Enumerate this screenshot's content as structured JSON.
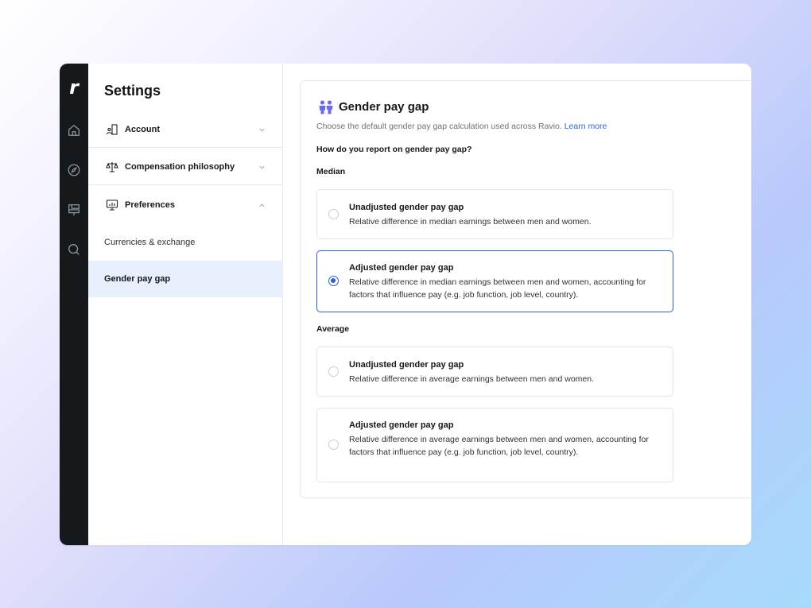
{
  "rail": {
    "logo": "r",
    "icons": [
      "home-icon",
      "compass-icon",
      "layout-icon",
      "search-icon"
    ]
  },
  "sidebar": {
    "title": "Settings",
    "sections": [
      {
        "label": "Account",
        "icon": "building-user-icon",
        "expanded": false
      },
      {
        "label": "Compensation philosophy",
        "icon": "scale-icon",
        "expanded": false
      },
      {
        "label": "Preferences",
        "icon": "monitor-chart-icon",
        "expanded": true
      }
    ],
    "sub_items": [
      {
        "label": "Currencies & exchange",
        "active": false
      },
      {
        "label": "Gender pay gap",
        "active": true
      }
    ]
  },
  "main": {
    "header": {
      "icon": "people-icon",
      "title": "Gender pay gap",
      "description": "Choose the default gender pay gap calculation used across Ravio.",
      "link": "Learn more"
    },
    "question": "How do you report on gender pay gap?",
    "groups": [
      {
        "label": "Median",
        "options": [
          {
            "title": "Unadjusted gender pay gap",
            "description": "Relative difference in median earnings between men and women.",
            "selected": false
          },
          {
            "title": "Adjusted gender pay gap",
            "description": "Relative difference in median earnings between men and women, accounting for factors that influence pay (e.g. job function, job level, country).",
            "selected": true
          }
        ]
      },
      {
        "label": "Average",
        "options": [
          {
            "title": "Unadjusted gender pay gap",
            "description": "Relative difference in average earnings between men and women.",
            "selected": false
          },
          {
            "title": "Adjusted gender pay gap",
            "description": "Relative difference in average earnings between men and women, accounting for factors that influence pay (e.g. job function, job level, country).",
            "selected": false
          }
        ]
      }
    ]
  },
  "colors": {
    "accent": "#2e5fd6",
    "rail": "#16191b",
    "active_bg": "#e8f0fd",
    "icon_purple": "#6f6ae8"
  }
}
